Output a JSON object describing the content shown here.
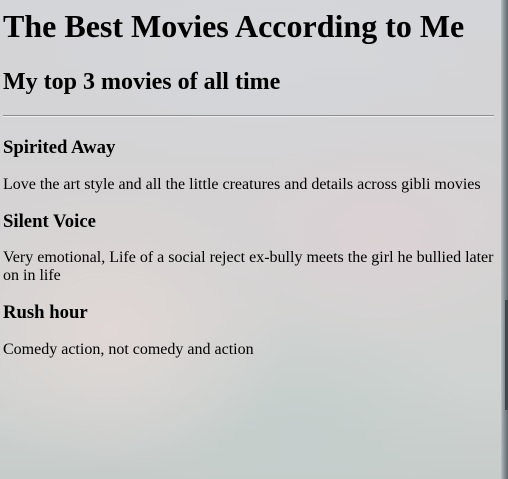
{
  "page": {
    "title": "The Best Movies According to Me",
    "subtitle": "My top 3 movies of all time"
  },
  "movies": [
    {
      "title": "Spirited Away",
      "description": "Love the art style and all the little creatures and details across gibli movies"
    },
    {
      "title": "Silent Voice",
      "description": "Very emotional, Life of a social reject ex-bully meets the girl he bullied later on in life"
    },
    {
      "title": "Rush hour",
      "description": "Comedy action, not comedy and action"
    }
  ]
}
